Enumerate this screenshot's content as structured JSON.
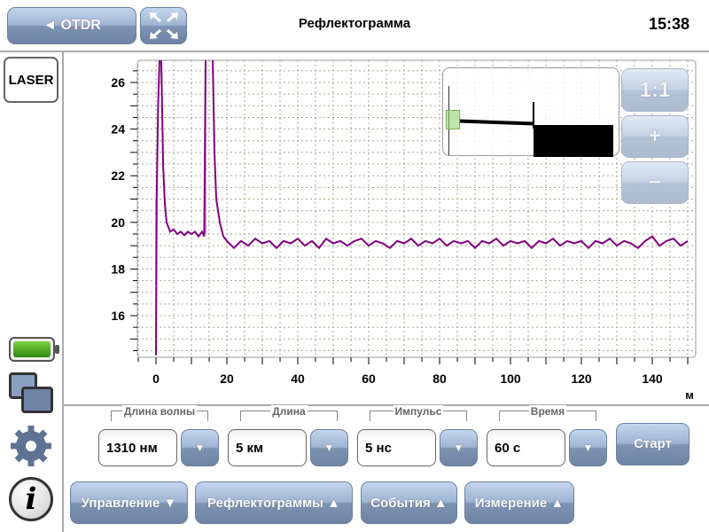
{
  "header": {
    "back_label": "◄ OTDR",
    "title": "Рефлектограмма",
    "time": "15:38"
  },
  "sidebar": {
    "laser_label": "LASER"
  },
  "zoom": {
    "one_to_one": "1:1",
    "plus": "+",
    "minus": "−"
  },
  "params": [
    {
      "label": "Длина волны",
      "value": "1310 нм"
    },
    {
      "label": "Длина",
      "value": "5 км"
    },
    {
      "label": "Импульс",
      "value": "5 нс"
    },
    {
      "label": "Время",
      "value": "60 с"
    }
  ],
  "start_label": "Старт",
  "menus": [
    "Управление ▼",
    "Рефлектограммы ▲",
    "События ▲",
    "Измерение ▲"
  ],
  "dropdown_glyph": "▼",
  "colors": {
    "trace": "#800080",
    "trace_light": "#c080c8",
    "battery": "#3aa018"
  },
  "chart_data": {
    "type": "line",
    "xlabel": "м",
    "ylabel": "",
    "xlim": [
      -5,
      152
    ],
    "ylim": [
      14.2,
      26.95
    ],
    "xticks": [
      0,
      20,
      40,
      60,
      80,
      100,
      120,
      140
    ],
    "yticks": [
      16,
      18,
      20,
      22,
      24,
      26
    ],
    "grid": true,
    "series": [
      {
        "name": "trace",
        "points": [
          [
            0,
            14.3
          ],
          [
            0.2,
            21
          ],
          [
            0.6,
            25
          ],
          [
            1,
            27
          ],
          [
            1.5,
            27
          ],
          [
            2,
            22.5
          ],
          [
            2.5,
            20.8
          ],
          [
            3,
            20
          ],
          [
            4,
            19.6
          ],
          [
            5,
            19.7
          ],
          [
            6,
            19.5
          ],
          [
            7,
            19.6
          ],
          [
            8,
            19.45
          ],
          [
            9,
            19.6
          ],
          [
            10,
            19.5
          ],
          [
            11,
            19.6
          ],
          [
            12,
            19.4
          ],
          [
            13,
            19.6
          ],
          [
            13.6,
            19.4
          ],
          [
            14,
            27
          ],
          [
            16,
            27
          ],
          [
            16.5,
            23
          ],
          [
            17,
            21
          ],
          [
            18,
            20
          ],
          [
            19,
            19.4
          ],
          [
            20,
            19.2
          ],
          [
            22,
            18.9
          ],
          [
            24,
            19.2
          ],
          [
            26,
            19.0
          ],
          [
            28,
            19.3
          ],
          [
            30,
            19.1
          ],
          [
            32,
            19.2
          ],
          [
            34,
            18.9
          ],
          [
            36,
            19.2
          ],
          [
            38,
            19.1
          ],
          [
            40,
            19.3
          ],
          [
            42,
            19.0
          ],
          [
            44,
            19.2
          ],
          [
            46,
            18.9
          ],
          [
            48,
            19.3
          ],
          [
            50,
            19.1
          ],
          [
            52,
            19.2
          ],
          [
            54,
            19.0
          ],
          [
            56,
            19.2
          ],
          [
            58,
            19.3
          ],
          [
            60,
            19.0
          ],
          [
            62,
            19.2
          ],
          [
            64,
            19.1
          ],
          [
            66,
            18.9
          ],
          [
            68,
            19.2
          ],
          [
            70,
            19.1
          ],
          [
            72,
            19.3
          ],
          [
            74,
            19.0
          ],
          [
            76,
            19.2
          ],
          [
            78,
            19.1
          ],
          [
            80,
            19.3
          ],
          [
            82,
            19.0
          ],
          [
            84,
            19.2
          ],
          [
            86,
            19.1
          ],
          [
            88,
            19.2
          ],
          [
            90,
            18.9
          ],
          [
            92,
            19.2
          ],
          [
            94,
            19.1
          ],
          [
            96,
            19.3
          ],
          [
            98,
            19.0
          ],
          [
            100,
            19.2
          ],
          [
            102,
            19.1
          ],
          [
            104,
            19.2
          ],
          [
            106,
            18.9
          ],
          [
            108,
            19.2
          ],
          [
            110,
            19.1
          ],
          [
            112,
            19.3
          ],
          [
            114,
            19.0
          ],
          [
            116,
            19.2
          ],
          [
            118,
            19.1
          ],
          [
            120,
            19.2
          ],
          [
            122,
            18.9
          ],
          [
            124,
            19.2
          ],
          [
            126,
            19.1
          ],
          [
            128,
            19.3
          ],
          [
            130,
            19.0
          ],
          [
            132,
            19.2
          ],
          [
            134,
            19.1
          ],
          [
            136,
            18.9
          ],
          [
            138,
            19.2
          ],
          [
            140,
            19.4
          ],
          [
            142,
            19.0
          ],
          [
            144,
            19.2
          ],
          [
            146,
            19.3
          ],
          [
            148,
            19.0
          ],
          [
            150,
            19.2
          ]
        ]
      }
    ]
  }
}
